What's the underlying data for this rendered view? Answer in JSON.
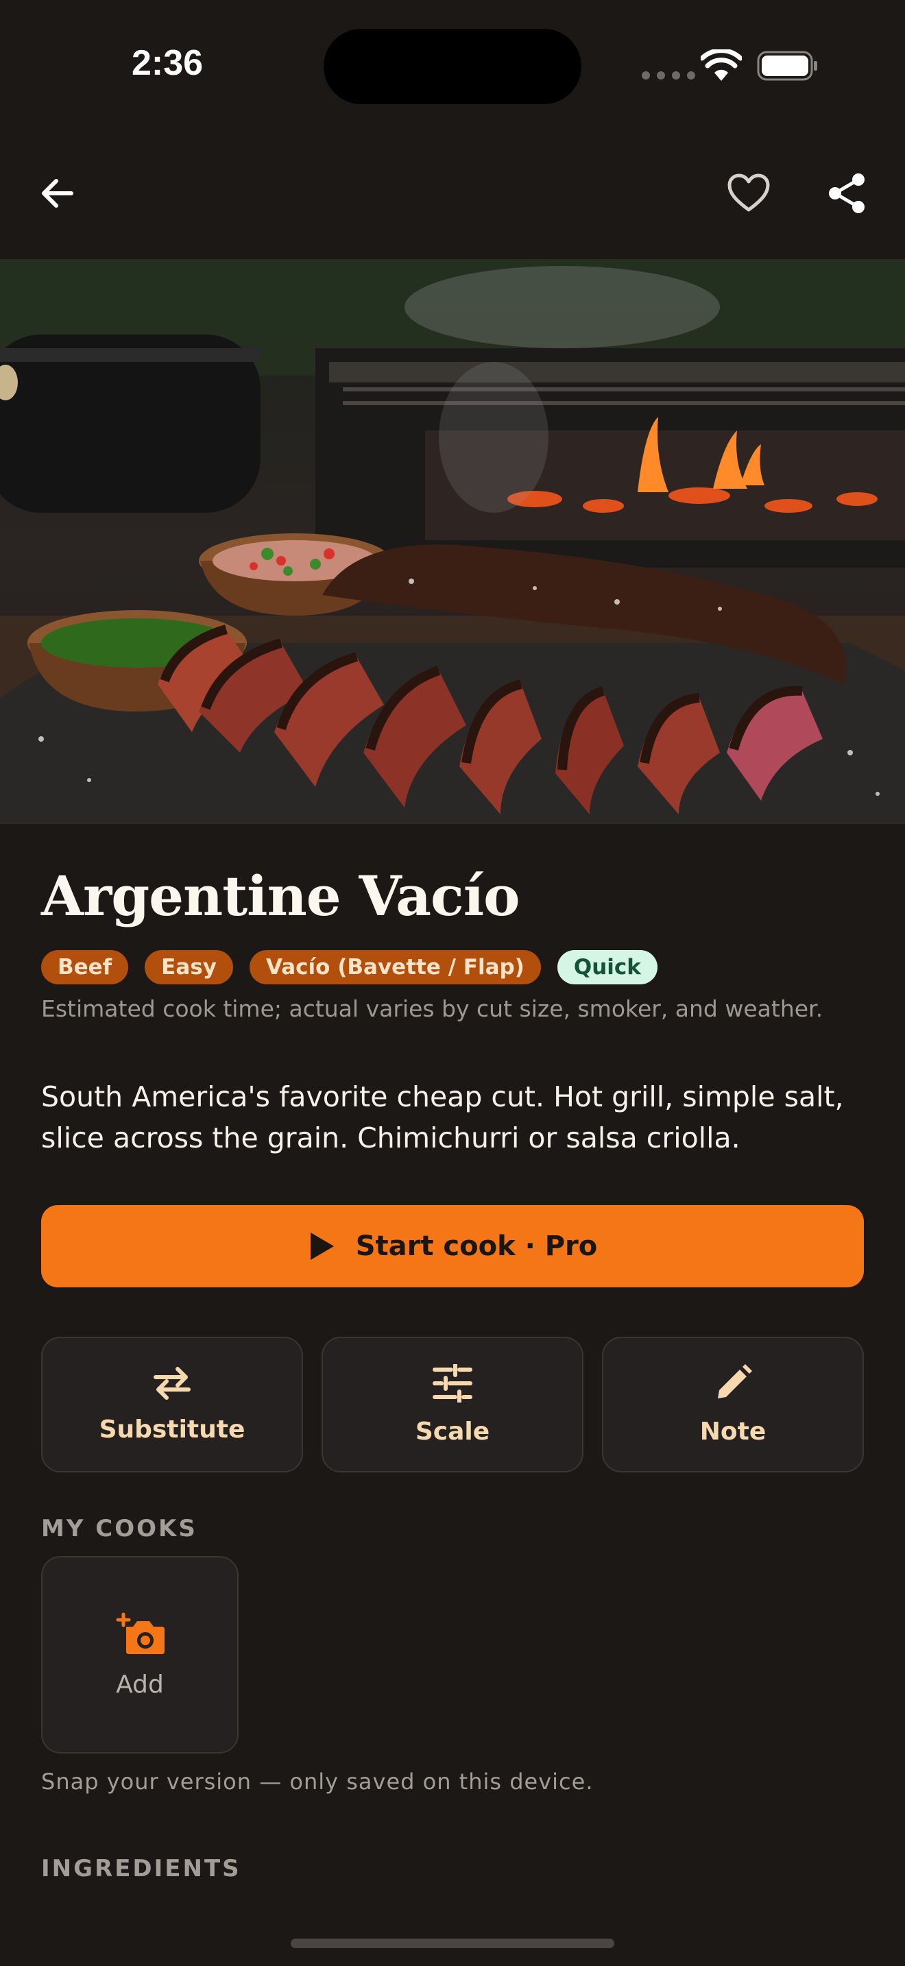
{
  "status_bar": {
    "time": "2:36"
  },
  "recipe": {
    "title": "Argentine Vacío",
    "tags": [
      {
        "label": "Beef",
        "style": "orange"
      },
      {
        "label": "Easy",
        "style": "orange"
      },
      {
        "label": "Vacío (Bavette / Flap)",
        "style": "orange"
      },
      {
        "label": "Quick",
        "style": "mint"
      }
    ],
    "disclaimer": "Estimated cook time; actual varies by cut size, smoker, and weather.",
    "description": "South America's favorite cheap cut. Hot grill, simple salt, slice across the grain. Chimichurri or salsa criolla."
  },
  "start_button": {
    "label": "Start cook · Pro"
  },
  "actions": [
    {
      "label": "Substitute",
      "icon": "swap-icon"
    },
    {
      "label": "Scale",
      "icon": "tune-icon"
    },
    {
      "label": "Note",
      "icon": "pencil-icon"
    }
  ],
  "my_cooks": {
    "heading": "MY COOKS",
    "add_label": "Add",
    "note": "Snap your version — only saved on this device."
  },
  "ingredients": {
    "heading": "INGREDIENTS"
  },
  "colors": {
    "background": "#1c1816",
    "accent": "#f47616",
    "tag_orange": "#b24f0c",
    "tag_mint": "#d5f6e4",
    "action_text": "#f6d9ae"
  }
}
